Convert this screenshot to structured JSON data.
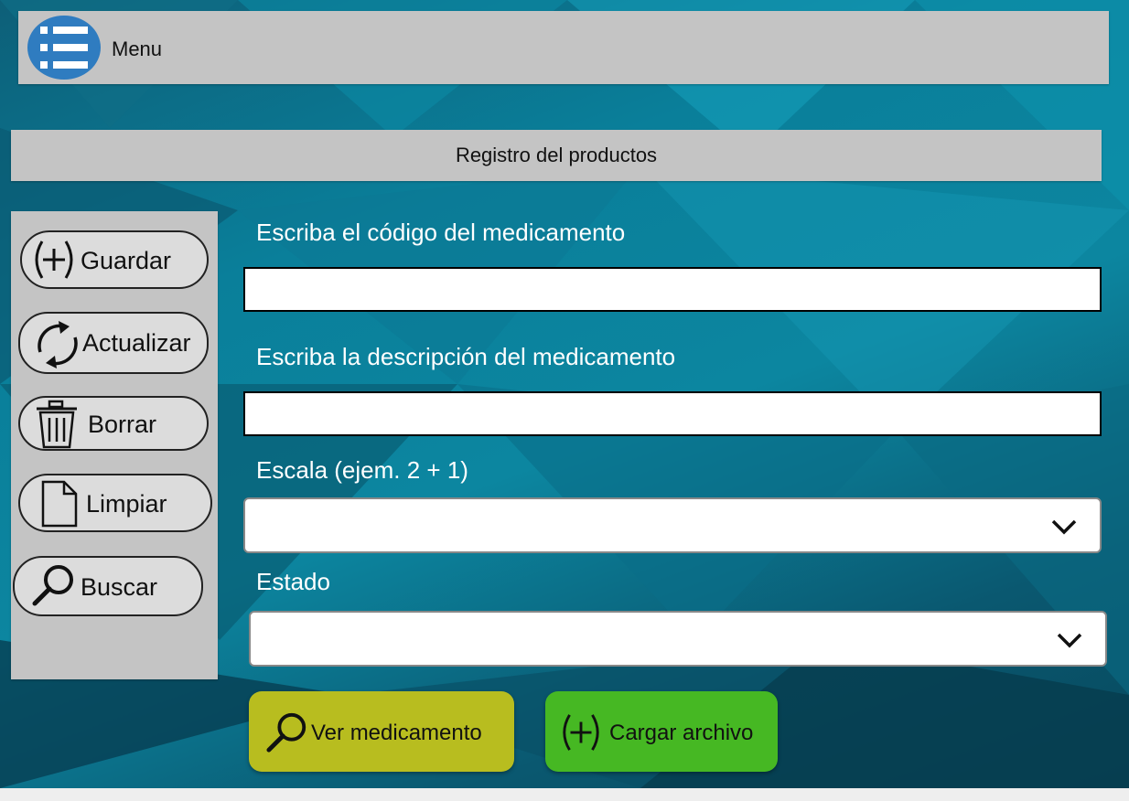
{
  "header": {
    "menu_label": "Menu"
  },
  "page": {
    "title": "Registro del productos"
  },
  "sidebar": {
    "buttons": [
      {
        "label": "Guardar",
        "icon": "plus-circle-icon"
      },
      {
        "label": "Actualizar",
        "icon": "refresh-icon"
      },
      {
        "label": "Borrar",
        "icon": "trash-icon"
      },
      {
        "label": "Limpiar",
        "icon": "document-icon"
      },
      {
        "label": "Buscar",
        "icon": "search-icon"
      }
    ]
  },
  "form": {
    "code_label": "Escriba el código del medicamento",
    "code_value": "",
    "description_label": "Escriba la descripción del medicamento",
    "description_value": "",
    "scale_label": "Escala (ejem. 2 + 1)",
    "scale_value": "",
    "status_label": "Estado",
    "status_value": ""
  },
  "actions": {
    "view_label": "Ver medicamento",
    "load_label": "Cargar archivo"
  },
  "colors": {
    "background": "#0a7f9a",
    "panel": "#c4c4c4",
    "menu_icon": "#2f7cc0",
    "view_button": "#b8bd1f",
    "load_button": "#46b823"
  }
}
